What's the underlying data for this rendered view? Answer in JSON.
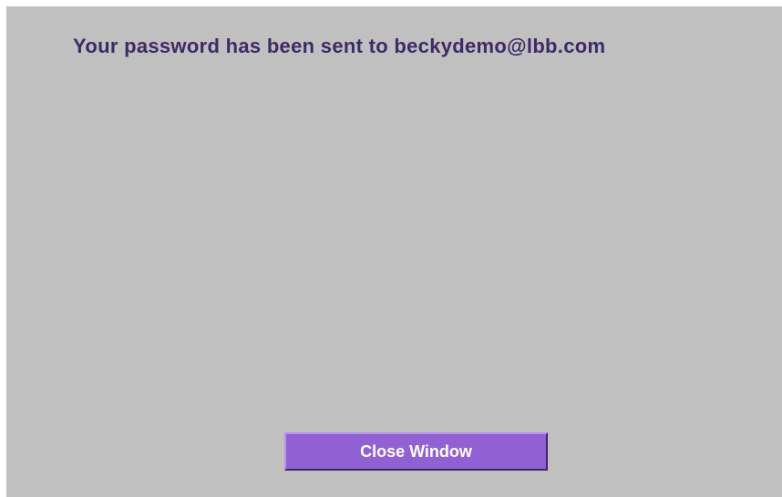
{
  "dialog": {
    "message": "Your password has been sent to beckydemo@lbb.com",
    "close_button_label": "Close Window"
  },
  "colors": {
    "background": "#c0c0c0",
    "message_text": "#3d2a66",
    "button_fill": "#9161d3",
    "button_text": "#ffffff"
  }
}
